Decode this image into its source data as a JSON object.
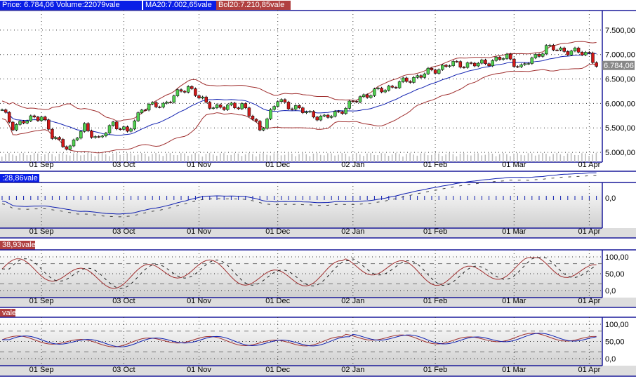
{
  "header": {
    "price_label": "Price: 6.784,06 Volume:22079vale",
    "ma_label": "MA20:7.002,65vale",
    "bol_label": "Bol20:7.210,85vale"
  },
  "panels": {
    "macd_label": ":28,86vale",
    "stoch_label": "38,93vale",
    "rsi_label": "vale"
  },
  "colors": {
    "up": "#50d050",
    "down": "#d01818",
    "ma": "#1020b0",
    "band": "#a03030",
    "axis": "#1a1a9a"
  },
  "chart_data": {
    "type": "candlestick",
    "x_ticks": [
      {
        "i": 11,
        "label": "01 Sep"
      },
      {
        "i": 34,
        "label": "03 Oct"
      },
      {
        "i": 55,
        "label": "01 Nov"
      },
      {
        "i": 77,
        "label": "01 Dec"
      },
      {
        "i": 98,
        "label": "02 Jan"
      },
      {
        "i": 121,
        "label": "01 Feb"
      },
      {
        "i": 143,
        "label": "01 Mar"
      },
      {
        "i": 164,
        "label": "01 Apr"
      }
    ],
    "price_ticks": [
      "7.500,00",
      "7.000,00",
      "6.500,00",
      "6.000,00",
      "5.500,00",
      "5.000,00"
    ],
    "price_tick_values": [
      7500,
      7000,
      6500,
      6000,
      5500,
      5000
    ],
    "ylim": [
      4800,
      7900
    ],
    "last_price": "6.784,06",
    "close_anchors": [
      [
        0,
        5840
      ],
      [
        3,
        5540
      ],
      [
        11,
        5760
      ],
      [
        14,
        5310
      ],
      [
        19,
        5090
      ],
      [
        23,
        5540
      ],
      [
        27,
        5240
      ],
      [
        31,
        5610
      ],
      [
        35,
        5390
      ],
      [
        39,
        5910
      ],
      [
        45,
        5980
      ],
      [
        52,
        6350
      ],
      [
        57,
        5980
      ],
      [
        62,
        5910
      ],
      [
        67,
        5980
      ],
      [
        72,
        5460
      ],
      [
        77,
        6060
      ],
      [
        84,
        5840
      ],
      [
        90,
        5690
      ],
      [
        96,
        5910
      ],
      [
        100,
        6130
      ],
      [
        109,
        6350
      ],
      [
        117,
        6580
      ],
      [
        125,
        6800
      ],
      [
        133,
        6800
      ],
      [
        141,
        6950
      ],
      [
        145,
        6730
      ],
      [
        152,
        7140
      ],
      [
        160,
        7050
      ],
      [
        164,
        7020
      ],
      [
        166,
        6784
      ]
    ],
    "macd_ticks": [
      "0,0"
    ],
    "osc_ticks": [
      "100,00",
      "50,00",
      "0,0"
    ]
  }
}
